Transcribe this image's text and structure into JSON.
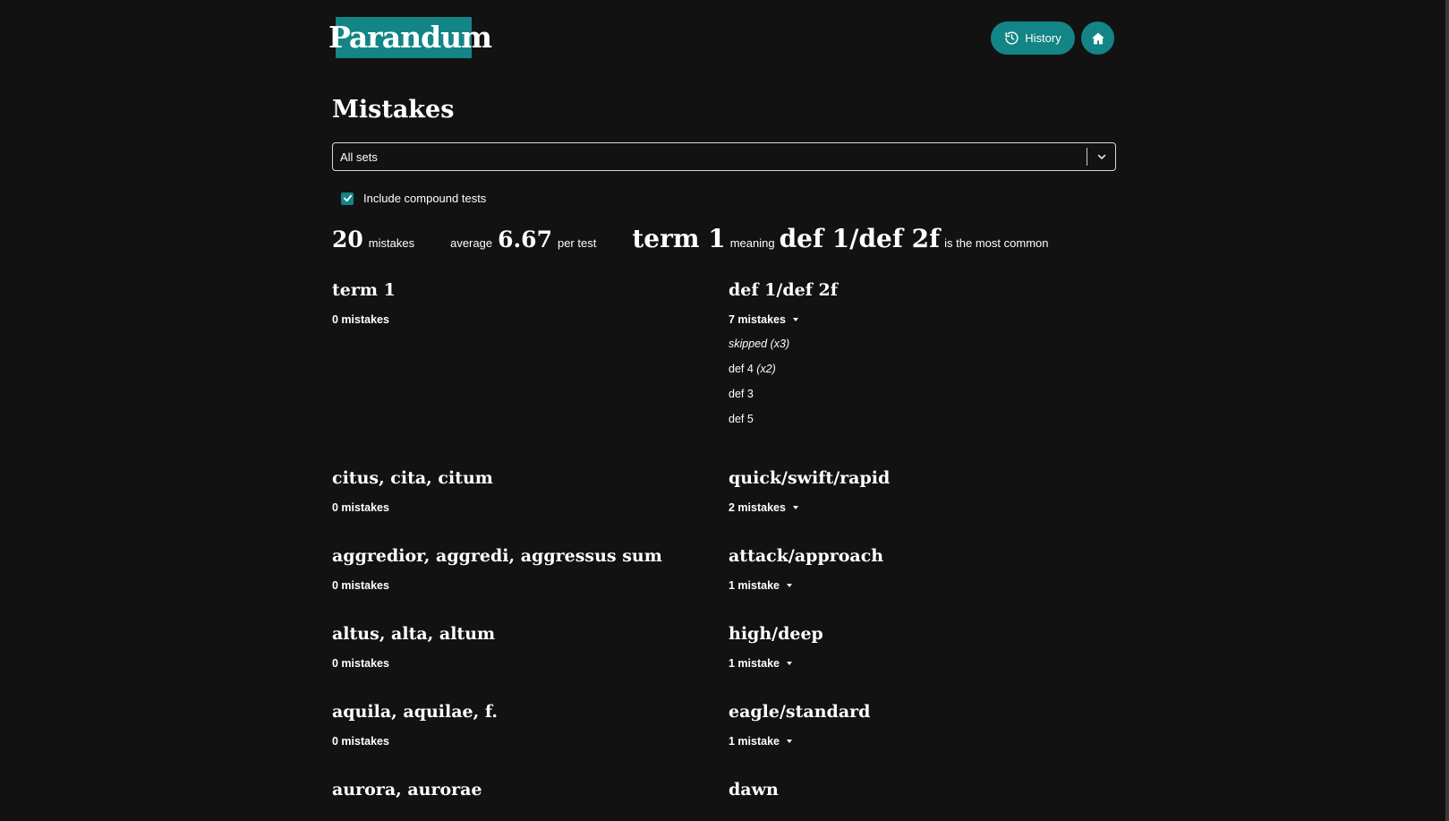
{
  "header": {
    "logo": "Parandum",
    "history_label": "History",
    "history_icon": "history-icon",
    "home_icon": "home-icon",
    "accent_color": "#138586"
  },
  "page": {
    "title": "Mistakes"
  },
  "filter": {
    "selected_set": "All sets",
    "include_compound_label": "Include compound tests",
    "include_compound_checked": true
  },
  "stats": {
    "mistakes_count": "20",
    "mistakes_label": "mistakes",
    "average_label": "average",
    "average_value": "6.67",
    "per_test_label": "per test",
    "common_term": "term 1",
    "meaning_label": "meaning",
    "common_meaning": "def 1/def 2f",
    "most_common_label": "is the most common"
  },
  "rows": [
    {
      "term": "term 1",
      "term_mistakes": "0 mistakes",
      "definition": "def 1/def 2f",
      "definition_mistakes": "7 mistakes",
      "details": [
        {
          "text": "skipped",
          "multiplier": "(x3)",
          "italic_text": true
        },
        {
          "text": "def 4",
          "multiplier": "(x2)",
          "italic_text": false
        },
        {
          "text": "def 3",
          "multiplier": "",
          "italic_text": false
        },
        {
          "text": "def 5",
          "multiplier": "",
          "italic_text": false
        }
      ]
    },
    {
      "term": "citus, cita, citum",
      "term_mistakes": "0 mistakes",
      "definition": "quick/swift/rapid",
      "definition_mistakes": "2 mistakes"
    },
    {
      "term": "aggredior, aggredi, aggressus sum",
      "term_mistakes": "0 mistakes",
      "definition": "attack/approach",
      "definition_mistakes": "1 mistake"
    },
    {
      "term": "altus, alta, altum",
      "term_mistakes": "0 mistakes",
      "definition": "high/deep",
      "definition_mistakes": "1 mistake"
    },
    {
      "term": "aquila, aquilae, f.",
      "term_mistakes": "0 mistakes",
      "definition": "eagle/standard",
      "definition_mistakes": "1 mistake"
    },
    {
      "term": "aurora, aurorae",
      "term_mistakes": "",
      "definition": "dawn",
      "definition_mistakes": ""
    }
  ]
}
